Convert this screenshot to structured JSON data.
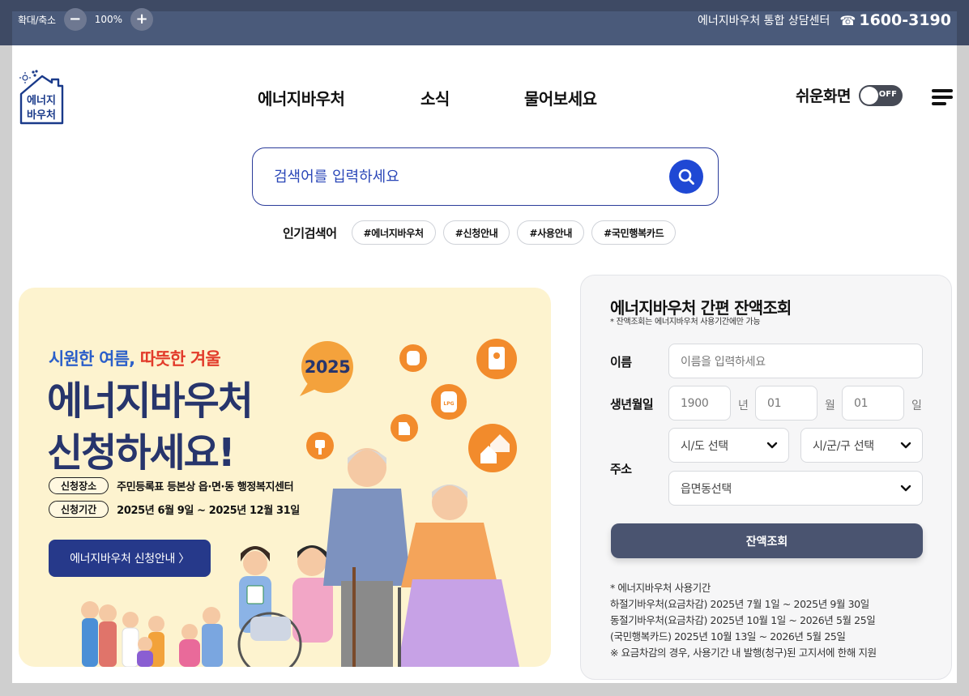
{
  "topbar": {
    "zoom_label": "확대/축소",
    "zoom_out": "−",
    "zoom_level": "100%",
    "zoom_in": "+",
    "callcenter_label": "에너지바우처 통합 상담센터",
    "phone_icon": "☎",
    "phone_number": "1600-3190"
  },
  "header": {
    "logo_line1": "에너지",
    "logo_line2": "바우처",
    "nav": [
      "에너지바우처",
      "소식",
      "물어보세요"
    ],
    "easy_mode_label": "쉬운화면",
    "toggle_state": "OFF"
  },
  "search": {
    "placeholder": "검색어를 입력하세요",
    "popular_label": "인기검색어",
    "popular_tags": [
      "#에너지바우처",
      "#신청안내",
      "#사용안내",
      "#국민행복카드"
    ]
  },
  "banner": {
    "subtitle_part1": "시원한 여름,",
    "subtitle_part2": "따뜻한 겨울",
    "title_line1": "에너지바우처",
    "title_line2": "신청하세요!",
    "badge_year": "2025",
    "place_label": "신청장소",
    "place_value": "주민등록표 등본상 읍·면·동 행정복지센터",
    "period_label": "신청기간",
    "period_value": "2025년 6월 9일 ~ 2025년 12월 31일",
    "button": "에너지바우처 신청안내 〉",
    "lpg_label": "LPG"
  },
  "balance": {
    "title": "에너지바우처 간편 잔액조회",
    "note": "* 잔액조회는 에너지바우처 사용기간에만 가능",
    "name_label": "이름",
    "name_placeholder": "이름을 입력하세요",
    "birth_label": "생년월일",
    "birth_year": "1900",
    "year_unit": "년",
    "birth_month": "01",
    "month_unit": "월",
    "birth_day": "01",
    "day_unit": "일",
    "address_label": "주소",
    "sido": "시/도 선택",
    "sigungu": "시/군/구 선택",
    "eupmyeondong": "읍면동선택",
    "submit": "잔액조회",
    "usage": [
      "* 에너지바우처 사용기간",
      "하절기바우처(요금차감) 2025년 7월 1일 ~ 2025년 9월 30일",
      "동절기바우처(요금차감) 2025년 10월 1일 ~ 2026년 5월 25일",
      "(국민행복카드) 2025년 10월 13일 ~ 2026년 5월 25일",
      "※ 요금차감의 경우, 사용기간 내 발행(청구)된 고지서에 한해 지원"
    ]
  },
  "colors": {
    "topbar": "#3e4a64",
    "search_accent": "#1f48d4",
    "banner_bg": "#fdf3cf",
    "banner_title": "#27356c",
    "submit_bg": "#4a5470"
  }
}
